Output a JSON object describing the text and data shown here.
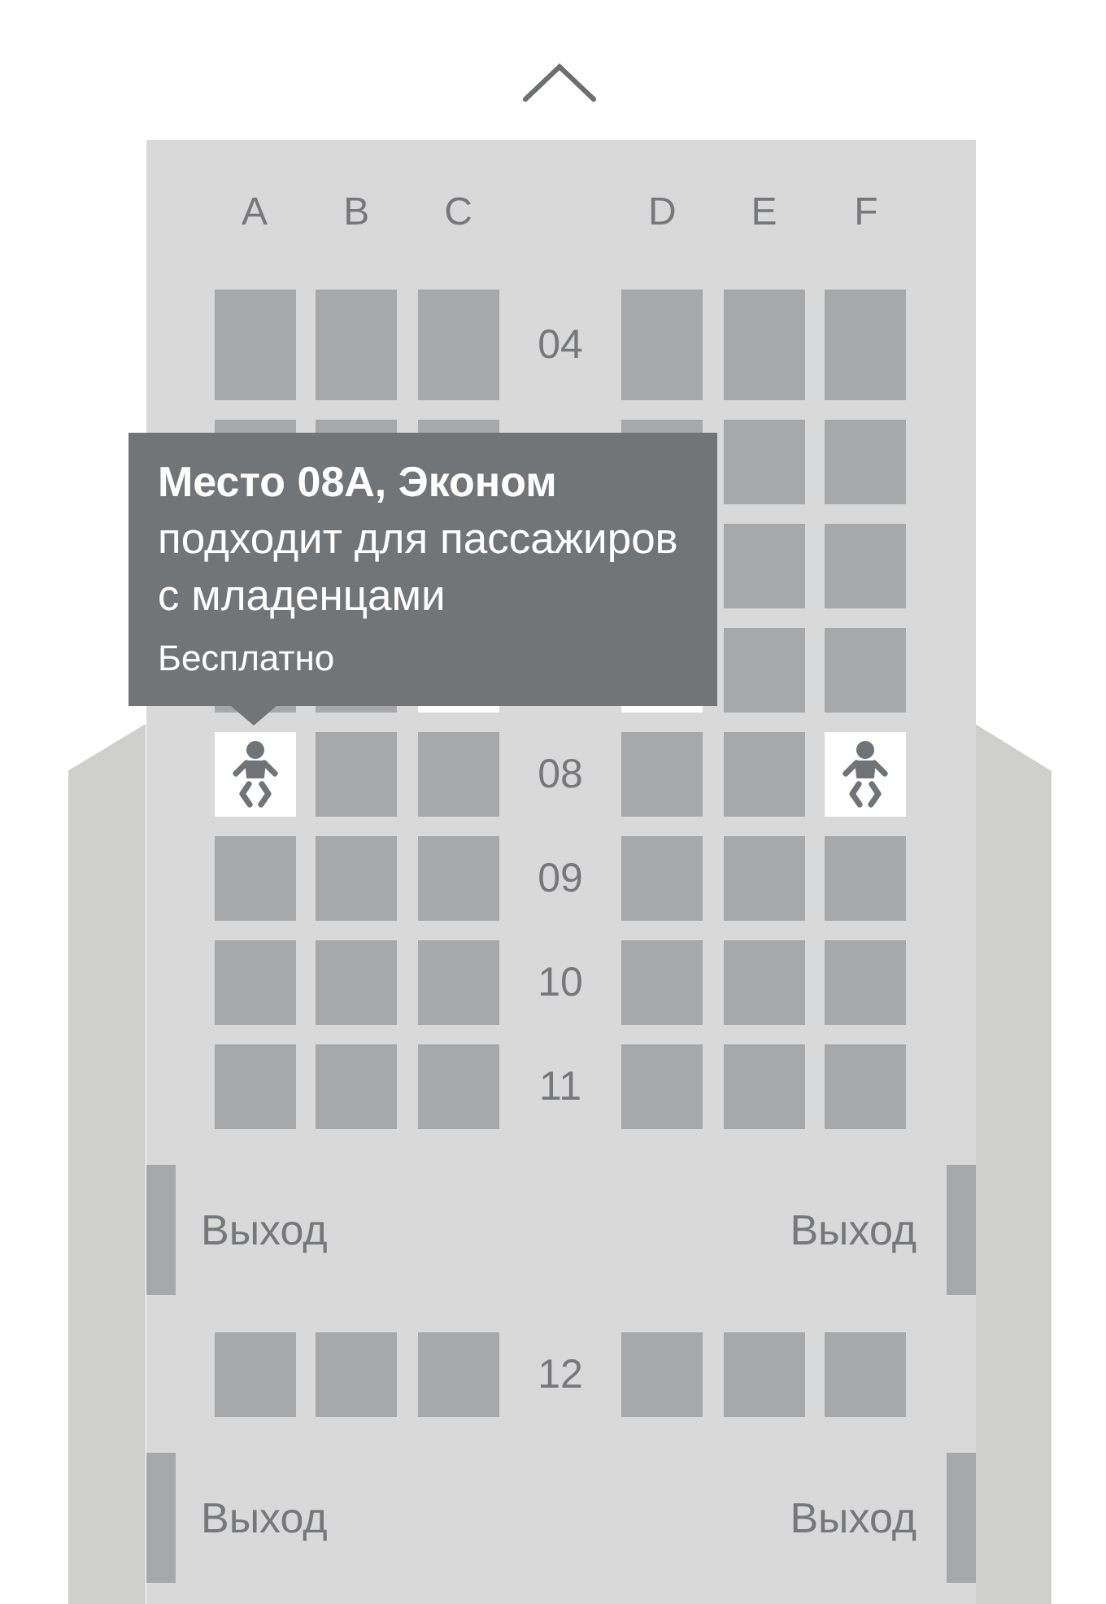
{
  "columns": {
    "left": [
      "A",
      "B",
      "C"
    ],
    "right": [
      "D",
      "E",
      "F"
    ]
  },
  "cabin": [
    {
      "kind": "row",
      "tall": true,
      "number": "04",
      "left": [
        {
          "available": false,
          "infant": false
        },
        {
          "available": false,
          "infant": false
        },
        {
          "available": false,
          "infant": false
        }
      ],
      "right": [
        {
          "available": false,
          "infant": false
        },
        {
          "available": false,
          "infant": false
        },
        {
          "available": false,
          "infant": false
        }
      ]
    },
    {
      "kind": "row",
      "tall": false,
      "left": [
        {
          "available": false
        },
        {
          "available": false
        },
        {
          "available": false
        }
      ],
      "right": [
        {
          "available": false
        },
        {
          "available": false,
          "infant": false
        },
        {
          "available": false,
          "infant": false
        }
      ]
    },
    {
      "kind": "row",
      "tall": false,
      "right": [
        {
          "available": false,
          "infant": false
        },
        {
          "available": false,
          "infant": false
        }
      ]
    },
    {
      "kind": "row",
      "tall": false,
      "left": [
        {
          "available": false
        },
        {
          "available": false
        },
        {
          "available": true
        }
      ],
      "right": [
        {
          "available": true
        },
        {
          "available": false,
          "infant": false
        },
        {
          "available": false,
          "infant": false
        }
      ]
    },
    {
      "kind": "row",
      "tall": false,
      "number": "08",
      "left": [
        {
          "available": true,
          "infant": true
        },
        {
          "available": false,
          "infant": false
        },
        {
          "available": false,
          "infant": false
        }
      ],
      "right": [
        {
          "available": false,
          "infant": false
        },
        {
          "available": false,
          "infant": false
        },
        {
          "available": true,
          "infant": true
        }
      ]
    },
    {
      "kind": "row",
      "tall": false,
      "number": "09",
      "left": [
        {
          "available": false,
          "infant": false
        },
        {
          "available": false,
          "infant": false
        },
        {
          "available": false,
          "infant": false
        }
      ],
      "right": [
        {
          "available": false,
          "infant": false
        },
        {
          "available": false,
          "infant": false
        },
        {
          "available": false,
          "infant": false
        }
      ]
    },
    {
      "kind": "row",
      "tall": false,
      "number": "10",
      "left": [
        {
          "available": false,
          "infant": false
        },
        {
          "available": false,
          "infant": false
        },
        {
          "available": false,
          "infant": false
        }
      ],
      "right": [
        {
          "available": false,
          "infant": false
        },
        {
          "available": false,
          "infant": false
        },
        {
          "available": false,
          "infant": false
        }
      ]
    },
    {
      "kind": "row",
      "tall": false,
      "number": "11",
      "left": [
        {
          "available": false,
          "infant": false
        },
        {
          "available": false,
          "infant": false
        },
        {
          "available": false,
          "infant": false
        }
      ],
      "right": [
        {
          "available": false,
          "infant": false
        },
        {
          "available": false,
          "infant": false
        },
        {
          "available": false,
          "infant": false
        }
      ]
    },
    {
      "kind": "exit",
      "left": "Выход",
      "right": "Выход"
    },
    {
      "kind": "row",
      "tall": false,
      "number": "12",
      "left": [
        {
          "available": false,
          "infant": false
        },
        {
          "available": false,
          "infant": false
        },
        {
          "available": false,
          "infant": false
        }
      ],
      "right": [
        {
          "available": false,
          "infant": false
        },
        {
          "available": false,
          "infant": false
        },
        {
          "available": false,
          "infant": false
        }
      ]
    },
    {
      "kind": "exit",
      "left": "Выход",
      "right": "Выход"
    }
  ],
  "tooltip": {
    "title": "Место 08A, Эконом",
    "description": "подходит для пассажиров с младенцами",
    "price": "Бесплатно"
  }
}
